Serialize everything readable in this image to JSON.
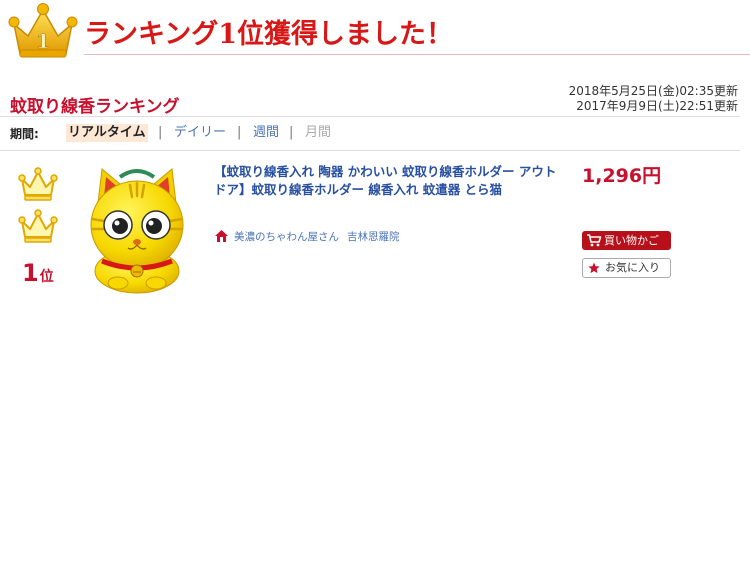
{
  "banner": {
    "title": "ランキング1位獲得しました！",
    "crown_digit": "1",
    "crown_color": "#f2b600",
    "title_color": "#d81717"
  },
  "ranking": {
    "title": "蚊取り線香ランキング",
    "updated_1": "2018年5月25日(金)02:35更新",
    "updated_2": "2017年9月9日(土)22:51更新"
  },
  "period": {
    "label": "期間:",
    "tabs": [
      {
        "label": "リアルタイム",
        "state": "active"
      },
      {
        "label": "デイリー",
        "state": "link"
      },
      {
        "label": "週間",
        "state": "link"
      },
      {
        "label": "月間",
        "state": "disabled"
      }
    ],
    "separator": "|"
  },
  "item": {
    "rank_number": "1",
    "rank_unit": "位",
    "title": "【蚊取り線香入れ 陶器 かわいい 蚊取り線香ホルダー アウトドア】蚊取り線香ホルダー 線香入れ 蚊遣器 とら猫",
    "shop_name": "美濃のちゃわん屋さん",
    "shop_extra": "吉林恩羅院",
    "price": "1,296円",
    "cart_label": "買い物かご",
    "favorite_label": "お気に入り",
    "icons": {
      "rank": "crown-icon",
      "shop": "home-icon",
      "cart": "cart-icon",
      "favorite": "star-icon"
    },
    "accent_color": "#c8102e"
  }
}
